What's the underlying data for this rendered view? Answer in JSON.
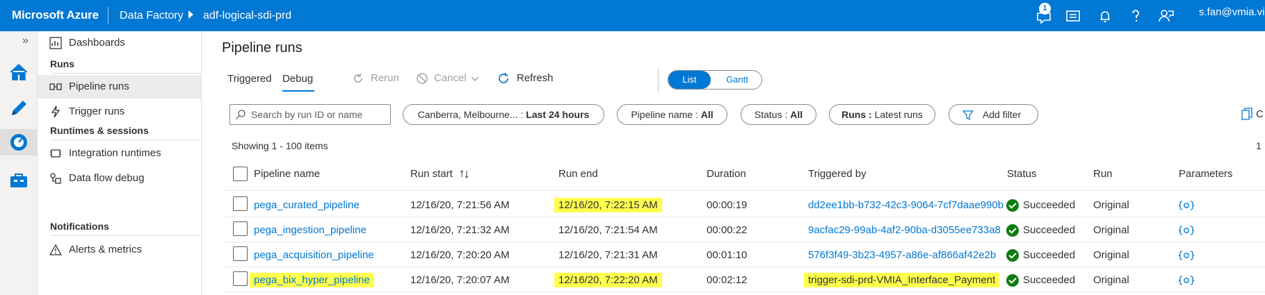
{
  "topbar": {
    "brand": "Microsoft Azure",
    "service": "Data Factory",
    "factory": "adf-logical-sdi-prd",
    "notification_count": "1",
    "user": "s.fan@vmia.vic.gov.au",
    "icons": [
      "feedback-icon",
      "switch-directory-icon",
      "notifications-icon",
      "help-icon",
      "feedback-person-icon"
    ]
  },
  "rail": {
    "expand": "»",
    "items": [
      "home-icon",
      "author-pencil-icon",
      "monitor-gauge-icon",
      "manage-toolbox-icon"
    ]
  },
  "nav": {
    "dashboards": "Dashboards",
    "runs_head": "Runs",
    "pipeline_runs": "Pipeline runs",
    "trigger_runs": "Trigger runs",
    "runtimes_head": "Runtimes & sessions",
    "integration_runtimes": "Integration runtimes",
    "dataflow_debug": "Data flow debug",
    "notifications_head": "Notifications",
    "alerts": "Alerts & metrics"
  },
  "main": {
    "title": "Pipeline runs",
    "tab_triggered": "Triggered",
    "tab_debug": "Debug",
    "rerun": "Rerun",
    "cancel": "Cancel",
    "refresh": "Refresh",
    "view_list": "List",
    "view_gantt": "Gantt",
    "search_placeholder": "Search by run ID or name",
    "filter_time_prefix": "Canberra, Melbourne... :",
    "filter_time_value": "Last 24 hours",
    "filter_pipeline_prefix": "Pipeline name :",
    "filter_pipeline_value": "All",
    "filter_status_prefix": "Status :",
    "filter_status_value": "All",
    "filter_runs_prefix": "Runs :",
    "filter_runs_value": "Latest runs",
    "add_filter": "Add filter",
    "clipped_right": "C",
    "showing": "Showing 1 - 100 items",
    "page": "1"
  },
  "table": {
    "headers": [
      "Pipeline name",
      "Run start",
      "Run end",
      "Duration",
      "Triggered by",
      "Status",
      "Run",
      "Parameters"
    ],
    "sort_icon": "sort-up-down-icon",
    "rows": [
      {
        "name": "pega_curated_pipeline",
        "start": "12/16/20, 7:21:56 AM",
        "end": "12/16/20, 7:22:15 AM",
        "duration": "00:00:19",
        "triggered_by": "dd2ee1bb-b732-42c3-9064-7cf7daae990b",
        "status": "Succeeded",
        "run": "Original",
        "highlight_name": false,
        "highlight_end": true,
        "highlight_trigger": false
      },
      {
        "name": "pega_ingestion_pipeline",
        "start": "12/16/20, 7:21:32 AM",
        "end": "12/16/20, 7:21:54 AM",
        "duration": "00:00:22",
        "triggered_by": "9acfac29-99ab-4af2-90ba-d3055ee733a8",
        "status": "Succeeded",
        "run": "Original",
        "highlight_name": false,
        "highlight_end": false,
        "highlight_trigger": false
      },
      {
        "name": "pega_acquisition_pipeline",
        "start": "12/16/20, 7:20:20 AM",
        "end": "12/16/20, 7:21:31 AM",
        "duration": "00:01:10",
        "triggered_by": "576f3f49-3b23-4957-a86e-af866af42e2b",
        "status": "Succeeded",
        "run": "Original",
        "highlight_name": false,
        "highlight_end": false,
        "highlight_trigger": false
      },
      {
        "name": "pega_bix_hyper_pipeline",
        "start": "12/16/20, 7:20:07 AM",
        "end": "12/16/20, 7:22:20 AM",
        "duration": "00:02:12",
        "triggered_by": "trigger-sdi-prd-VMIA_Interface_Payment",
        "status": "Succeeded",
        "run": "Original",
        "highlight_name": true,
        "highlight_end": true,
        "highlight_trigger": true
      }
    ]
  },
  "colors": {
    "accent": "#0078d4",
    "success": "#107c10",
    "highlight": "#ffff4d"
  }
}
